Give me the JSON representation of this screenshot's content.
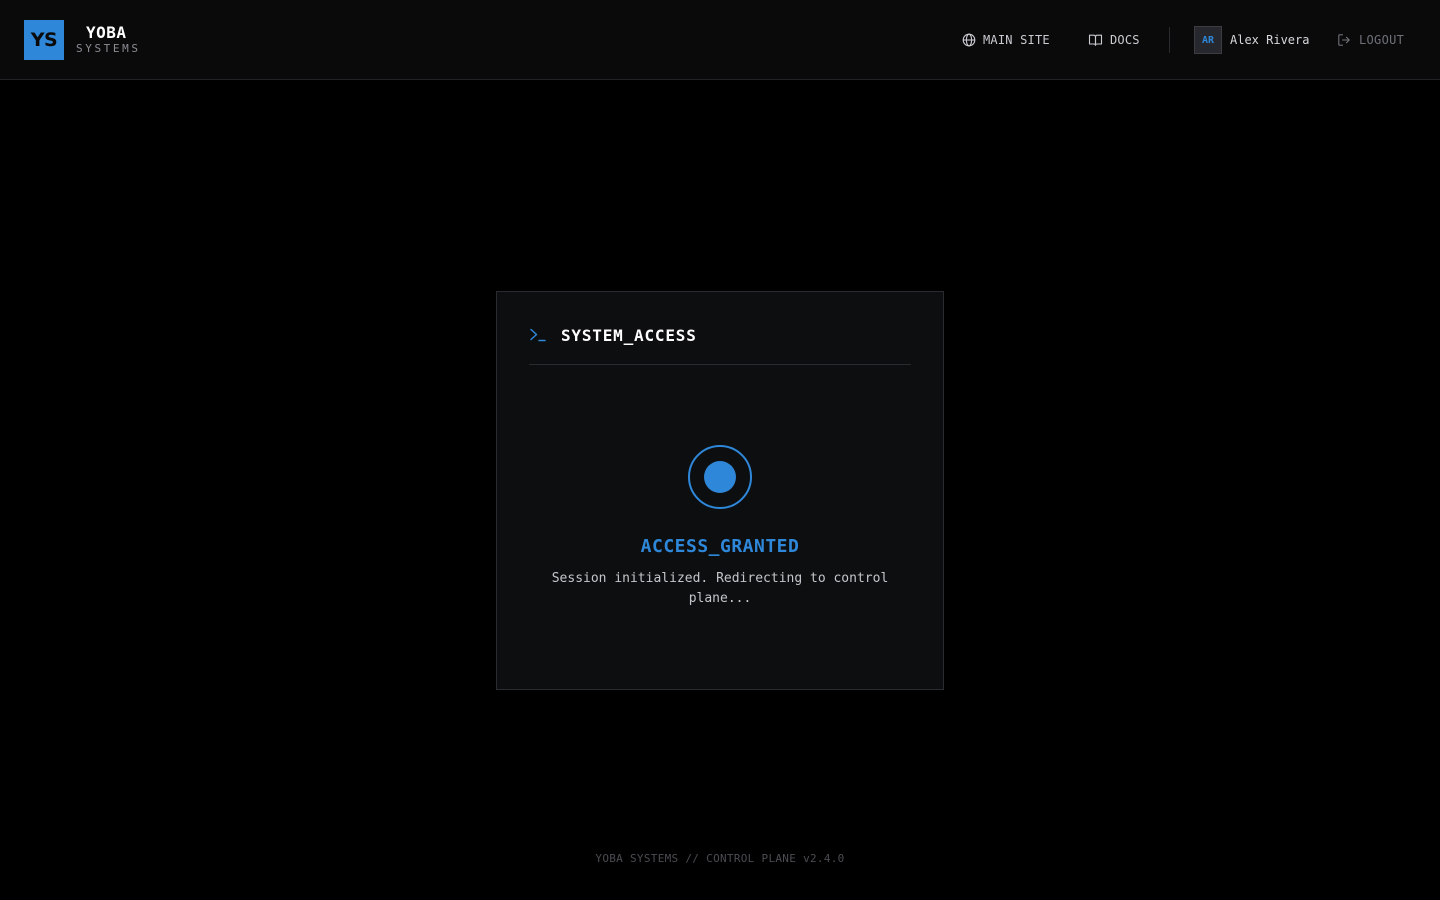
{
  "header": {
    "logo_mark": "YS",
    "brand_name": "YOBA",
    "brand_sub": "SYSTEMS",
    "nav": {
      "main_site": {
        "label": "MAIN SITE",
        "icon": "globe-icon"
      },
      "docs": {
        "label": "DOCS",
        "icon": "book-icon"
      }
    },
    "user": {
      "initials": "AR",
      "name": "Alex Rivera"
    },
    "logout": {
      "label": "LOGOUT",
      "icon": "logout-icon"
    }
  },
  "card": {
    "icon": "terminal-prompt-icon",
    "title": "SYSTEM_ACCESS",
    "status_icon": "status-indicator-icon",
    "status_title": "ACCESS_GRANTED",
    "status_message": "Session initialized. Redirecting to control plane..."
  },
  "footer": {
    "text": "YOBA SYSTEMS // CONTROL PLANE v2.4.0"
  },
  "colors": {
    "accent": "#2e87d9",
    "background": "#000000",
    "surface": "#0d0e10",
    "topbar": "#0a0a0b"
  }
}
